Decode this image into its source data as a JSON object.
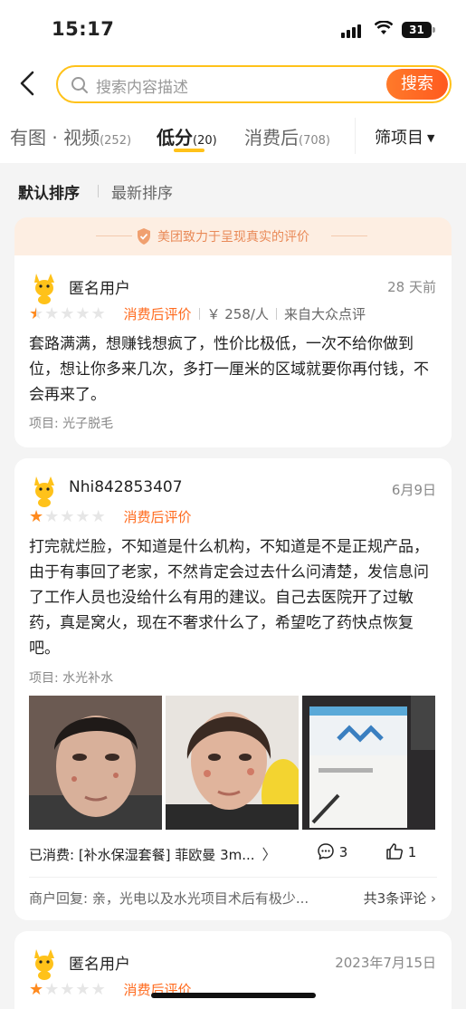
{
  "status_bar": {
    "time": "15:17",
    "battery": "31"
  },
  "search": {
    "placeholder": "搜索内容描述",
    "button": "搜索"
  },
  "tabs": [
    {
      "label": "有图 · 视频",
      "count": "(252)",
      "active": false
    },
    {
      "label": "低分",
      "count": "(20)",
      "active": true
    },
    {
      "label": "消费后",
      "count": "(708)",
      "active": false
    }
  ],
  "filter": {
    "label": "筛项目"
  },
  "sort": {
    "default": "默认排序",
    "latest": "最新排序"
  },
  "banner": {
    "text": "美团致力于呈现真实的评价"
  },
  "reviews": [
    {
      "user": "匿名用户",
      "date": "28 天前",
      "rating": 0.5,
      "tag": "消费后评价",
      "price": "￥ 258/人",
      "source": "来自大众点评",
      "text": "套路满满，想赚钱想疯了，性价比极低，一次不给你做到位，想让你多来几次，多打一厘米的区域就要你再付钱，不会再来了。",
      "project": "项目: 光子脱毛"
    },
    {
      "user": "Nhi842853407",
      "date": "6月9日",
      "rating": 1,
      "tag": "消费后评价",
      "text": "打完就烂脸，不知道是什么机构，不知道是不是正规产品，由于有事回了老家，不然肯定会过去什么问清楚，发信息问了工作人员也没给什么有用的建议。自己去医院开了过敏药，真是窝火，现在不奢求什么了，希望吃了药快点恢复吧。",
      "project": "项目: 水光补水",
      "consumed": "已消费: [补水保湿套餐] 菲欧曼 3m...",
      "comments": "3",
      "likes": "1",
      "reply_label": "商户回复:",
      "reply": "亲，光电以及水光项目术后有极少...",
      "reply_more": "共3条评论"
    },
    {
      "user": "匿名用户",
      "date": "2023年7月15日",
      "rating": 1,
      "tag": "消费后评价"
    }
  ],
  "colors": {
    "accent": "#ff6b1f",
    "search_border": "#ffc21a",
    "star": "#ff8a1e"
  }
}
